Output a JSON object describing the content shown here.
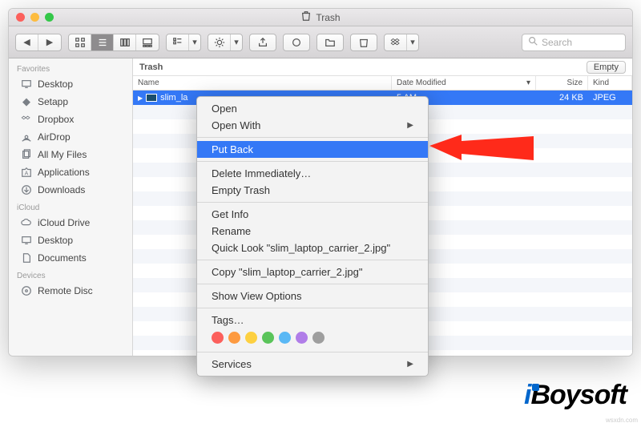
{
  "window": {
    "title": "Trash"
  },
  "toolbar": {
    "search_placeholder": "Search"
  },
  "sidebar": {
    "sections": [
      {
        "label": "Favorites",
        "items": [
          {
            "label": "Desktop"
          },
          {
            "label": "Setapp"
          },
          {
            "label": "Dropbox"
          },
          {
            "label": "AirDrop"
          },
          {
            "label": "All My Files"
          },
          {
            "label": "Applications"
          },
          {
            "label": "Downloads"
          }
        ]
      },
      {
        "label": "iCloud",
        "items": [
          {
            "label": "iCloud Drive"
          },
          {
            "label": "Desktop"
          },
          {
            "label": "Documents"
          }
        ]
      },
      {
        "label": "Devices",
        "items": [
          {
            "label": "Remote Disc"
          }
        ]
      }
    ]
  },
  "content": {
    "path": "Trash",
    "empty_label": "Empty",
    "columns": {
      "name": "Name",
      "date": "Date Modified",
      "size": "Size",
      "kind": "Kind"
    },
    "rows": [
      {
        "name": "slim_la",
        "date": "5 AM",
        "size": "24 KB",
        "kind": "JPEG",
        "selected": true
      }
    ]
  },
  "context_menu": {
    "items": [
      {
        "label": "Open"
      },
      {
        "label": "Open With",
        "submenu": true
      }
    ],
    "sep1": true,
    "highlighted": {
      "label": "Put Back"
    },
    "sep2": true,
    "group2": [
      {
        "label": "Delete Immediately…"
      },
      {
        "label": "Empty Trash"
      }
    ],
    "sep3": true,
    "group3": [
      {
        "label": "Get Info"
      },
      {
        "label": "Rename"
      },
      {
        "label": "Quick Look \"slim_laptop_carrier_2.jpg\""
      }
    ],
    "sep4": true,
    "copy": {
      "label": "Copy \"slim_laptop_carrier_2.jpg\""
    },
    "sep5": true,
    "viewopts": {
      "label": "Show View Options"
    },
    "sep6": true,
    "tags_label": "Tags…",
    "tag_colors": [
      "#fc605c",
      "#fd9a40",
      "#fdd040",
      "#5ac45a",
      "#5ab8f5",
      "#b07de8",
      "#9e9e9e"
    ],
    "sep7": true,
    "services": {
      "label": "Services",
      "submenu": true
    }
  },
  "brand": {
    "text_i": "i",
    "text_rest": "Boysoft"
  },
  "credit": "wsxdn.com"
}
